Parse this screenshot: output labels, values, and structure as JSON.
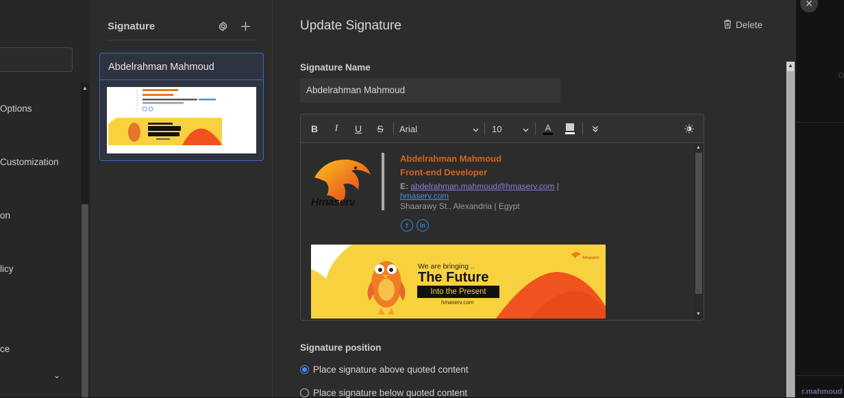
{
  "sidebar": {
    "items": [
      {
        "label": "Options"
      },
      {
        "label": "Customization"
      },
      {
        "label": "on"
      },
      {
        "label": "licy"
      },
      {
        "label": "ce"
      }
    ]
  },
  "signature_panel": {
    "title": "Signature",
    "cards": [
      {
        "name": "Abdelrahman Mahmoud"
      }
    ]
  },
  "editor": {
    "title": "Update Signature",
    "delete_label": "Delete",
    "name_label": "Signature Name",
    "name_value": "Abdelrahman Mahmoud",
    "toolbar": {
      "bold": "B",
      "italic": "I",
      "underline": "U",
      "strike": "S",
      "font": "Arial",
      "size": "10",
      "text_color_glyph": "A"
    },
    "signature": {
      "logo_text": "Hmaserv",
      "name": "Abdelrahman Mahmoud",
      "role": "Front-end Developer",
      "email_label": "E:",
      "email": "abdelrahman.mahmoud@hmaserv.com",
      "separator": "|",
      "website": "hmaserv.com",
      "address": "Shaarawy St., Alexandria | Egypt",
      "social": [
        "f",
        "in"
      ],
      "banner": {
        "line1": "We are bringing ..",
        "line2": "The Future",
        "line3": "Into the Present",
        "url": "hmaserv.com",
        "brand": "hmaserv"
      }
    },
    "position_label": "Signature position",
    "positions": [
      {
        "label": "Place signature above quoted content",
        "selected": true
      },
      {
        "label": "Place signature below quoted content",
        "selected": false
      }
    ]
  },
  "background": {
    "bottom_text": "r.mahmoud"
  },
  "colors": {
    "accent": "#3c68c9",
    "signature_orange": "#d1651e",
    "banner_yellow": "#f8d23e",
    "radio_blue": "#4b86f0"
  }
}
